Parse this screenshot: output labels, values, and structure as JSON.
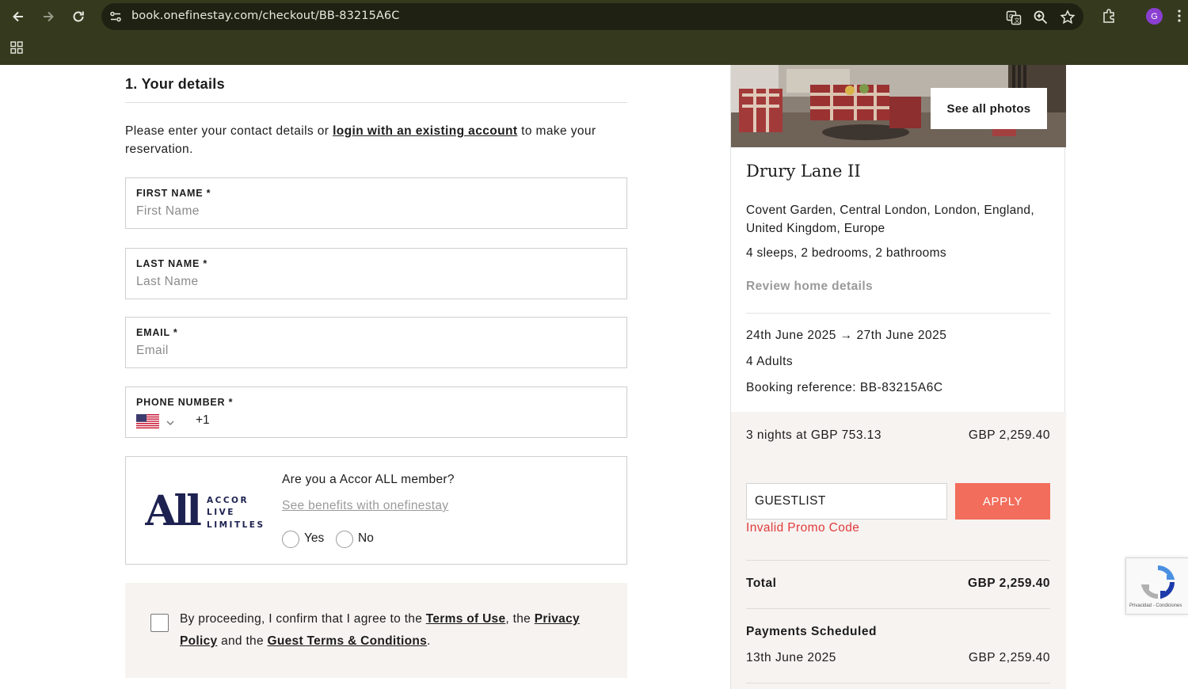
{
  "browser": {
    "url": "book.onefinestay.com/checkout/BB-83215A6C",
    "profile_initial": "G"
  },
  "form": {
    "section_title": "1. Your details",
    "intro_before": "Please enter your contact details or ",
    "intro_link": "login with an existing account",
    "intro_after": " to make your reservation.",
    "first_name": {
      "label": "FIRST NAME *",
      "placeholder": "First Name",
      "value": ""
    },
    "last_name": {
      "label": "LAST NAME *",
      "placeholder": "Last Name",
      "value": ""
    },
    "email": {
      "label": "EMAIL *",
      "placeholder": "Email",
      "value": ""
    },
    "phone": {
      "label": "PHONE NUMBER *",
      "country": "United States",
      "dial_code": "+1"
    },
    "accor": {
      "logo_main": "All",
      "logo_lines": [
        "ACCOR",
        "LIVE",
        "LIMITLESS"
      ],
      "question": "Are you a Accor ALL member?",
      "benefits_link": "See benefits with onefinestay",
      "yes_label": "Yes",
      "no_label": "No"
    },
    "consent": {
      "t1": "By proceeding, I confirm that I agree to the ",
      "terms_link": "Terms of Use",
      "t2": ", the ",
      "privacy_link": "Privacy Policy",
      "t3": " and the ",
      "guest_terms_link": "Guest Terms & Conditions",
      "t4": "."
    }
  },
  "summary": {
    "see_all_photos": "See all photos",
    "property_name": "Drury Lane II",
    "address": "Covent Garden, Central London, London, England, United Kingdom, Europe",
    "sleeps": "4 sleeps, 2 bedrooms, 2 bathrooms",
    "review_link": "Review home details",
    "dates": "24th June 2025 → 27th June 2025",
    "guests": "4 Adults",
    "booking_reference": "Booking reference: BB-83215A6C",
    "nights_label": "3 nights at GBP 753.13",
    "nights_amount": "GBP 2,259.40",
    "promo_value": "GUESTLIST",
    "apply_label": "APPLY",
    "promo_error": "Invalid Promo Code",
    "total_label": "Total",
    "total_amount": "GBP 2,259.40",
    "payments_label": "Payments Scheduled",
    "payment_date": "13th June 2025",
    "payment_amount": "GBP 2,259.40"
  },
  "recaptcha": {
    "footer": "Privacidad - Condiciones"
  },
  "colors": {
    "chrome_bg": "#353a1e",
    "accent_apply": "#f26d5b",
    "error": "#e03b3b",
    "summary_bg": "#f7f3f1",
    "accor_navy": "#1d2250"
  }
}
